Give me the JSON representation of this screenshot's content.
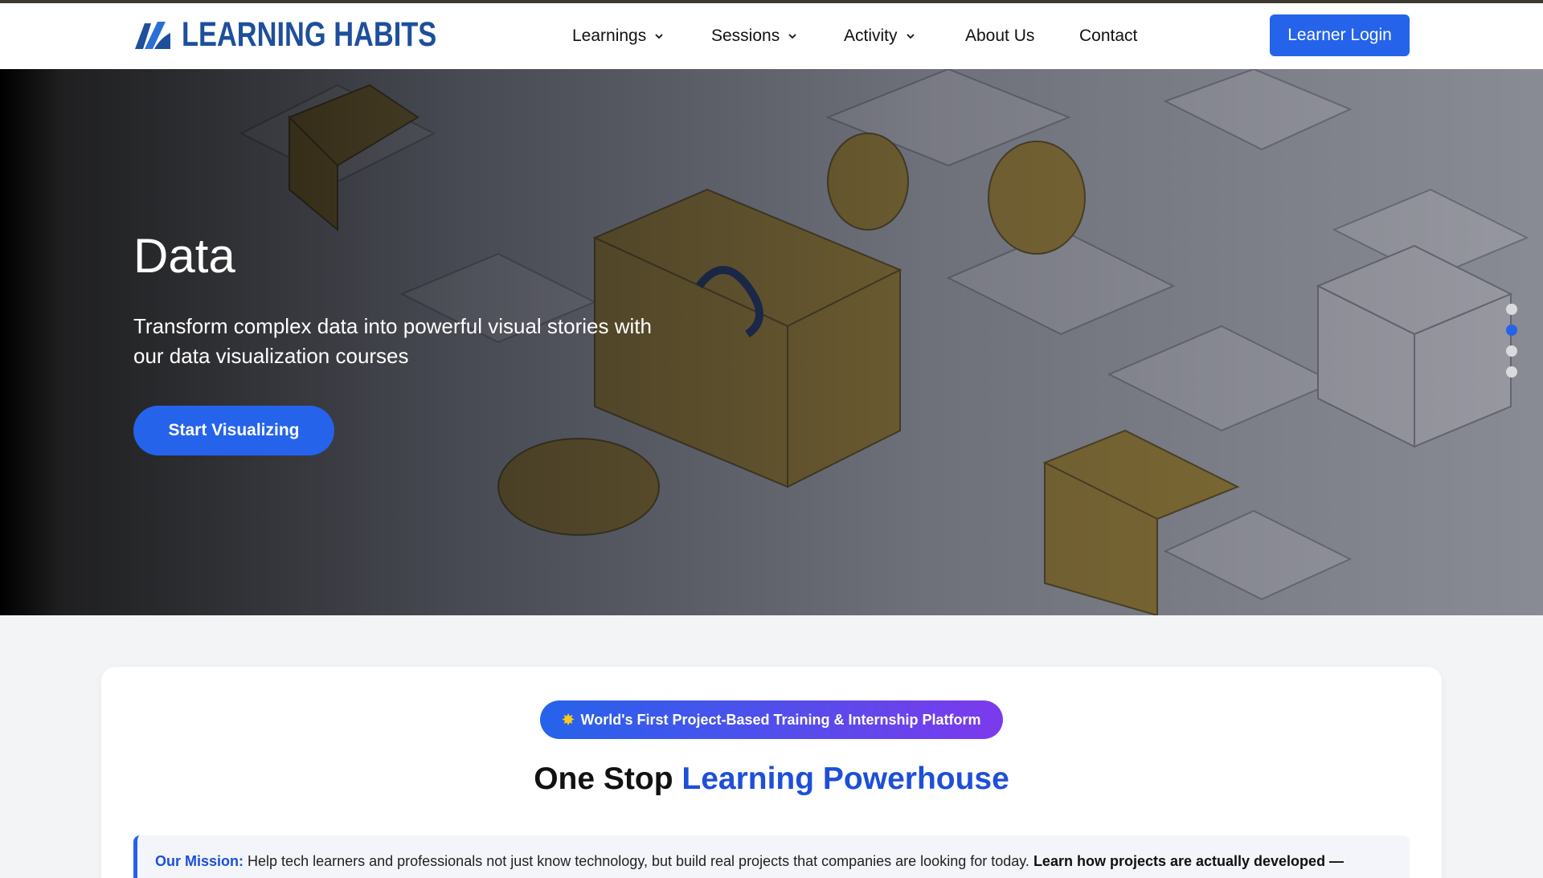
{
  "brand": {
    "name": "LEARNING HABITS",
    "color": "#1e4f9c",
    "icon": "learning-habits-logo-mark"
  },
  "nav": {
    "items": [
      {
        "label": "Learnings",
        "has_dropdown": true
      },
      {
        "label": "Sessions",
        "has_dropdown": true
      },
      {
        "label": "Activity",
        "has_dropdown": true
      },
      {
        "label": "About Us",
        "has_dropdown": false
      },
      {
        "label": "Contact",
        "has_dropdown": false
      }
    ],
    "login_label": "Learner Login"
  },
  "hero": {
    "title": "Data",
    "subtitle": "Transform complex data into powerful visual stories with our data visualization courses",
    "cta_label": "Start Visualizing",
    "slides_total": 4,
    "active_slide": 2
  },
  "intro": {
    "badge_icon": "sparkle-icon",
    "badge_label": "World's First Project-Based Training & Internship Platform",
    "heading_plain": "One Stop",
    "heading_accent": "Learning Powerhouse",
    "mission_label": "Our Mission:",
    "mission_text": "Help tech learners and professionals not just know technology, but build real projects that companies are looking for today.",
    "mission_bold": "Learn how projects are actually developed —"
  },
  "colors": {
    "accent": "#2563eb",
    "accent_dark": "#1d4fd8",
    "badge_gradient_end": "#7c3aed",
    "page_bg": "#f3f4f6"
  }
}
